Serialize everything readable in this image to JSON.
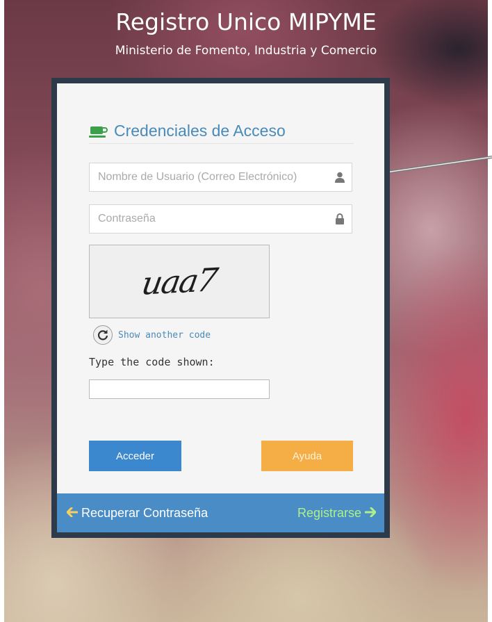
{
  "header": {
    "title": "Registro Unico MIPYME",
    "subtitle": "Ministerio de Fomento, Industria y Comercio"
  },
  "form": {
    "legend": "Credenciales de Acceso",
    "legend_icon": "coffee-cup-icon",
    "username_placeholder": "Nombre de Usuario (Correo Electrónico)",
    "username_value": "",
    "username_icon": "user-icon",
    "password_placeholder": "Contraseña",
    "password_value": "",
    "password_icon": "lock-icon",
    "captcha": {
      "image_text": "uaa7",
      "reload_icon": "refresh-icon",
      "reload_label": "Show another code",
      "prompt": "Type the code shown:",
      "input_value": ""
    },
    "buttons": {
      "submit_label": "Acceder",
      "help_label": "Ayuda"
    }
  },
  "footer": {
    "recover_label": "Recuperar Contraseña",
    "recover_icon": "arrow-left-icon",
    "register_label": "Registrarse",
    "register_icon": "arrow-right-icon"
  },
  "colors": {
    "accent_blue": "#3c88cf",
    "help_orange": "#f5ad45",
    "footer_blue": "#4a8cc5",
    "register_green": "#aef08a",
    "legend_blue": "#4a8ab8"
  }
}
